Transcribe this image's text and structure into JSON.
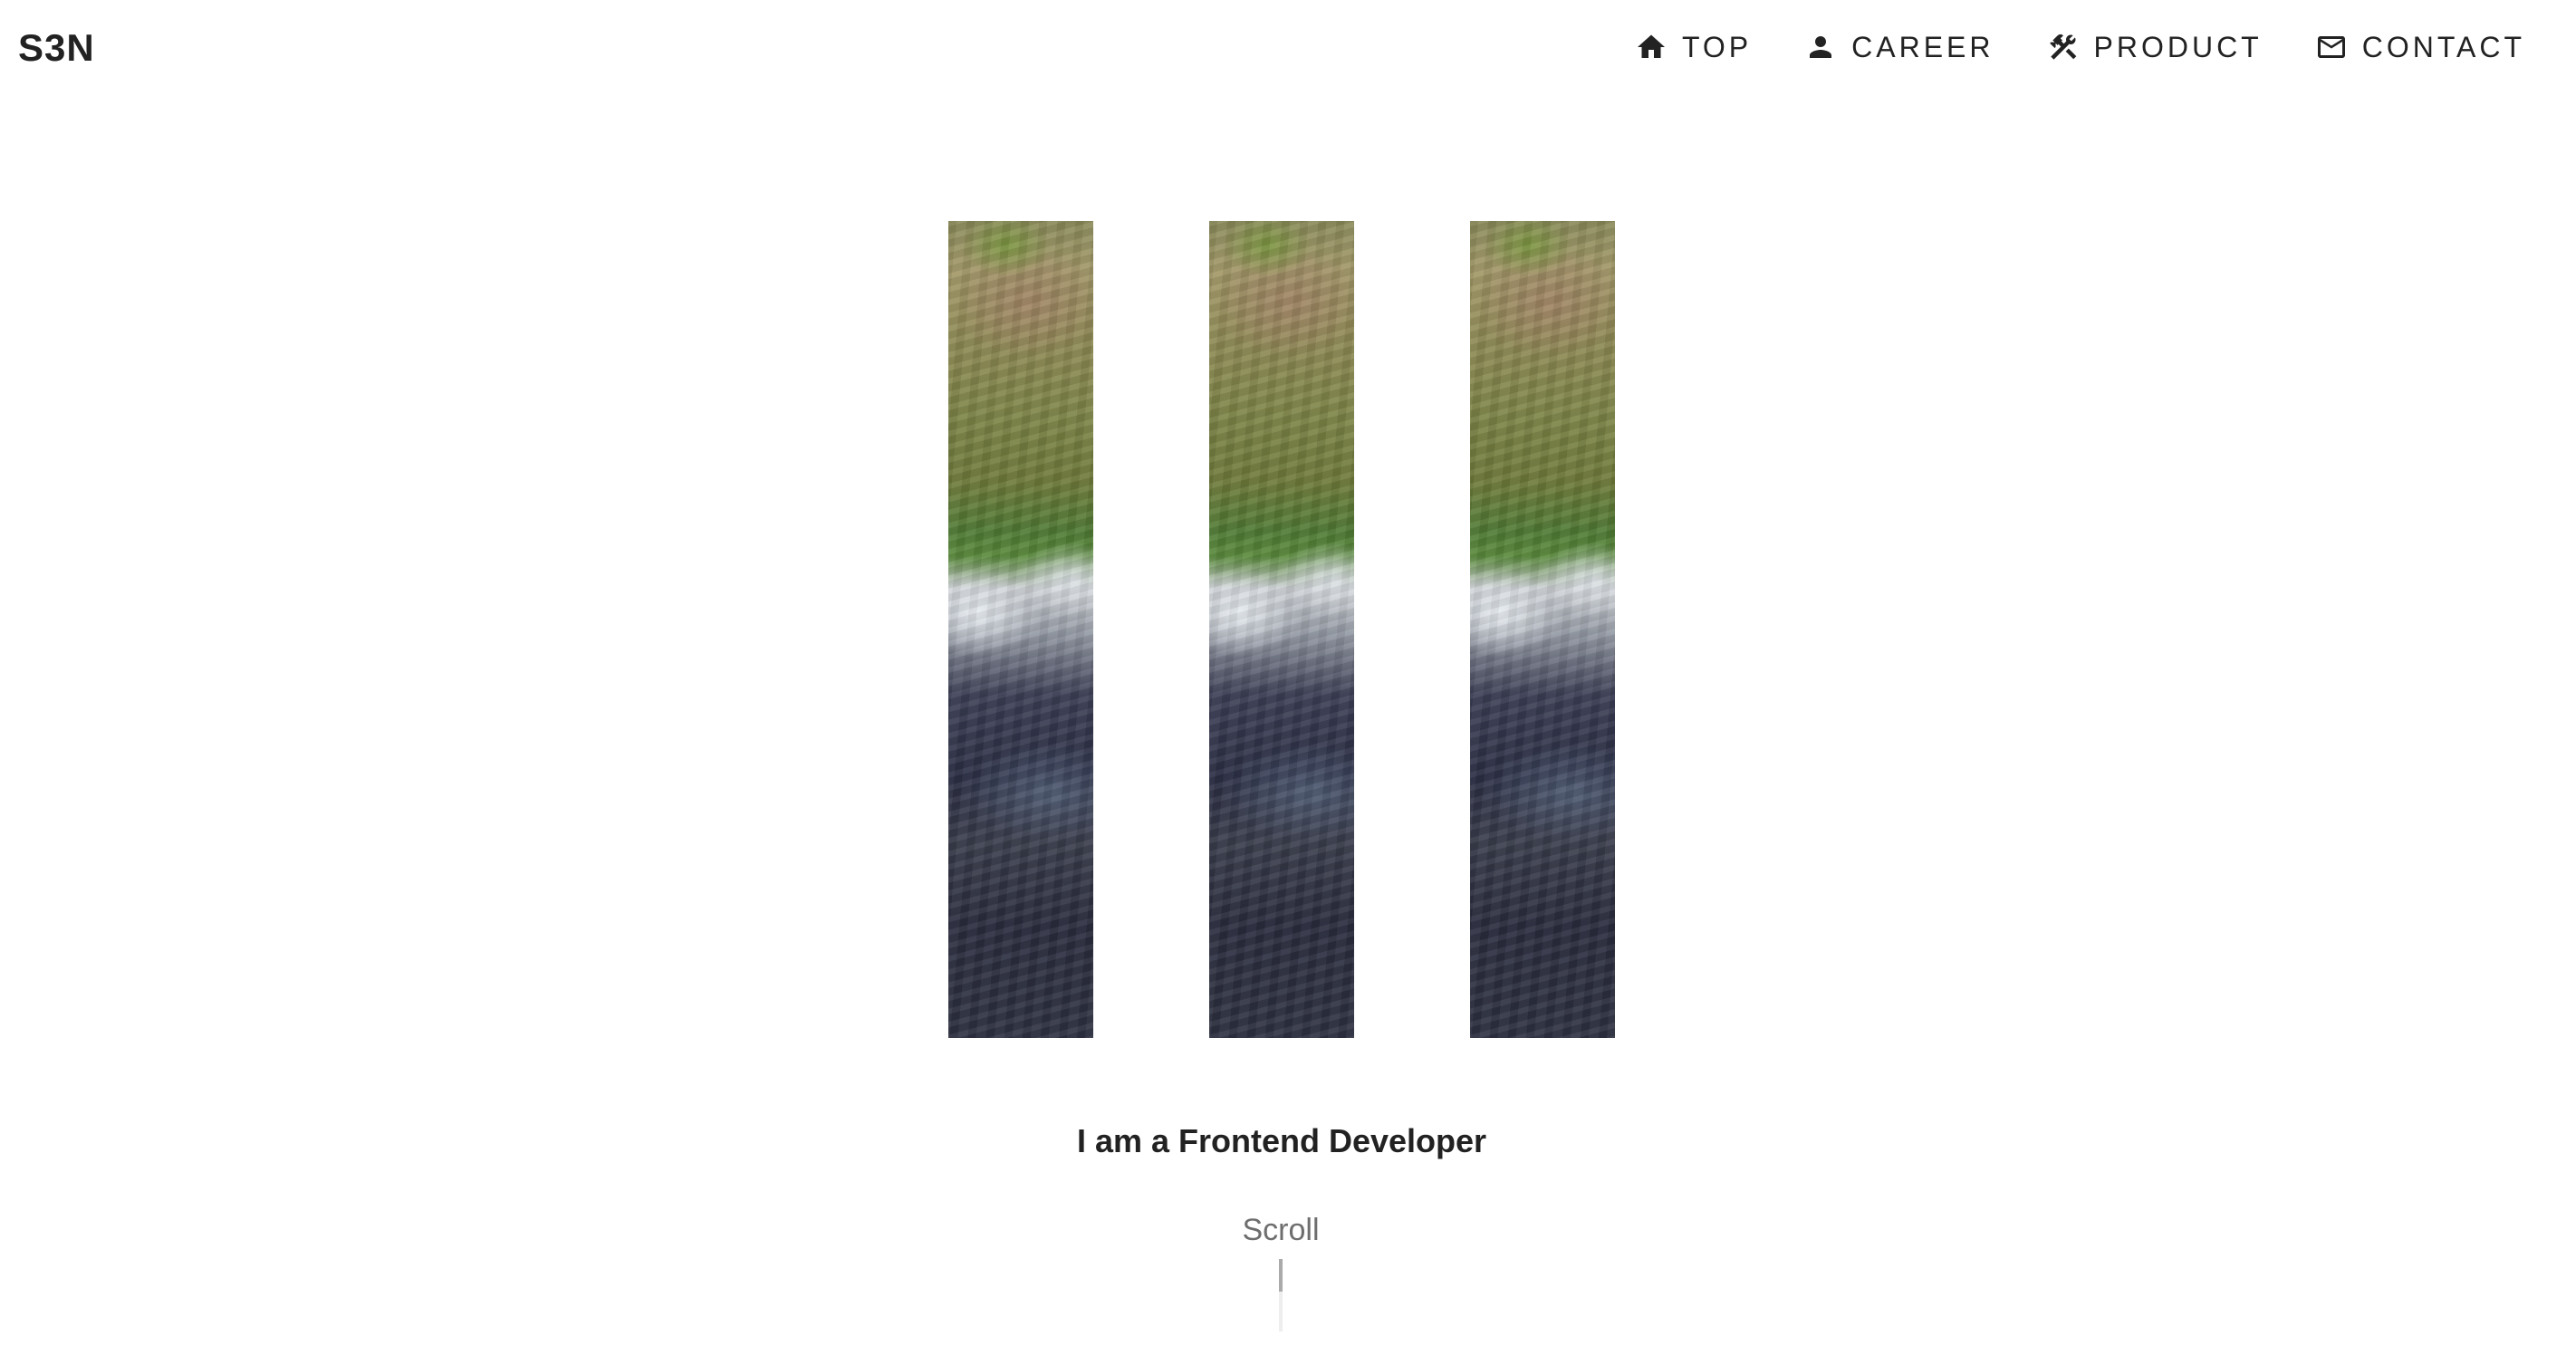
{
  "header": {
    "logo": "S3N",
    "nav": [
      {
        "label": "TOP",
        "icon": "home-icon"
      },
      {
        "label": "CAREER",
        "icon": "person-icon"
      },
      {
        "label": "PRODUCT",
        "icon": "tools-icon"
      },
      {
        "label": "CONTACT",
        "icon": "mail-icon"
      }
    ]
  },
  "hero": {
    "strip_count": 3,
    "tagline": "I am a Frontend Developer",
    "scroll_label": "Scroll"
  },
  "colors": {
    "text": "#222222",
    "muted": "#6e6e6e",
    "background": "#ffffff"
  }
}
